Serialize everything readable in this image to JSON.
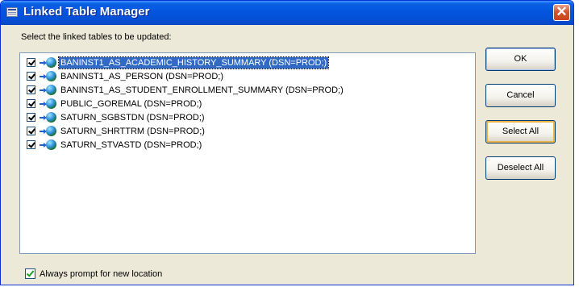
{
  "window": {
    "title": "Linked Table Manager",
    "close_glyph": "✕"
  },
  "prompt": {
    "label": "Select the linked tables to be updated:"
  },
  "tables": [
    {
      "label": "BANINST1_AS_ACADEMIC_HISTORY_SUMMARY   (DSN=PROD;)",
      "checked": true,
      "selected": true
    },
    {
      "label": "BANINST1_AS_PERSON   (DSN=PROD;)",
      "checked": true,
      "selected": false
    },
    {
      "label": "BANINST1_AS_STUDENT_ENROLLMENT_SUMMARY   (DSN=PROD;)",
      "checked": true,
      "selected": false
    },
    {
      "label": "PUBLIC_GOREMAL   (DSN=PROD;)",
      "checked": true,
      "selected": false
    },
    {
      "label": "SATURN_SGBSTDN   (DSN=PROD;)",
      "checked": true,
      "selected": false
    },
    {
      "label": "SATURN_SHRTTRM   (DSN=PROD;)",
      "checked": true,
      "selected": false
    },
    {
      "label": "SATURN_STVASTD   (DSN=PROD;)",
      "checked": true,
      "selected": false
    }
  ],
  "buttons": {
    "ok": "OK",
    "cancel": "Cancel",
    "select_all": "Select All",
    "deselect_all": "Deselect All"
  },
  "footer": {
    "always_prompt_label": "Always prompt for new location",
    "always_prompt_checked": true
  },
  "colors": {
    "titlebar": "#0455de",
    "selection": "#316ac5",
    "dialog_bg": "#ece9d8",
    "check_green": "#21a121"
  }
}
